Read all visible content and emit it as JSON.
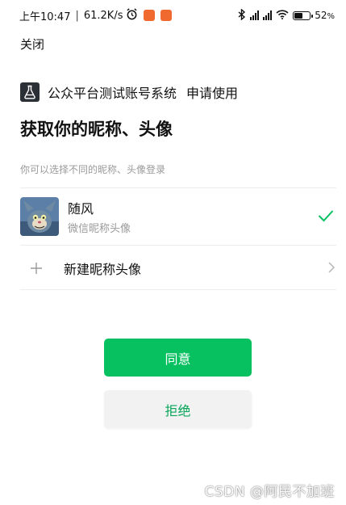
{
  "status_bar": {
    "time": "上午10:47",
    "speed": "61.2K/s",
    "battery": "52",
    "battery_unit": "%",
    "battery_level": 0.52
  },
  "header": {
    "close_label": "关闭"
  },
  "app": {
    "name": "公众平台测试账号系统",
    "apply_label": "申请使用",
    "icon": "flask-icon"
  },
  "main": {
    "title": "获取你的昵称、头像",
    "hint": "你可以选择不同的昵称、头像登录"
  },
  "options": {
    "current": {
      "name": "随风",
      "subtitle": "微信昵称头像",
      "selected": true
    },
    "new_label": "新建昵称头像"
  },
  "buttons": {
    "agree": "同意",
    "reject": "拒绝"
  },
  "watermark": "CSDN @阿民不加班",
  "colors": {
    "accent": "#07c160",
    "reject_text": "#07a558",
    "muted": "#9a9a9a"
  }
}
